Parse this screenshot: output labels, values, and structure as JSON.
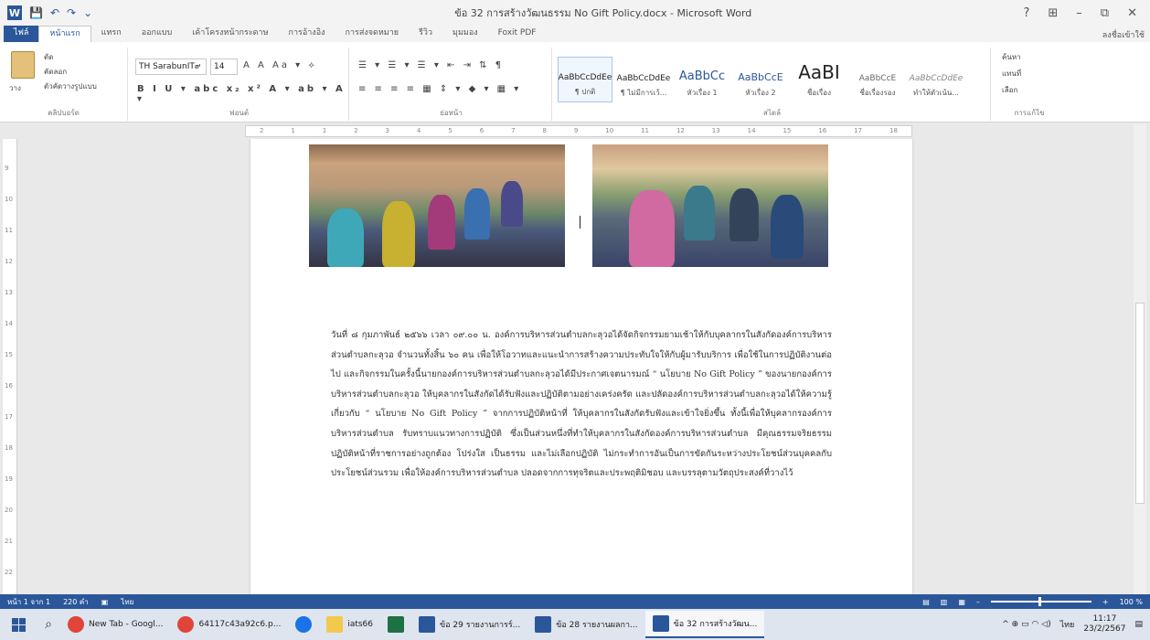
{
  "window": {
    "title": "ข้อ 32 การสร้างวัฒนธรรม No Gift Policy.docx - Microsoft Word",
    "controls": [
      "?",
      "⊞",
      "–",
      "⧉",
      "✕"
    ],
    "signin": "ลงชื่อเข้าใช้"
  },
  "qat": [
    "💾",
    "↶",
    "↷",
    "⌄"
  ],
  "tabs": [
    "ไฟล์",
    "หน้าแรก",
    "แทรก",
    "ออกแบบ",
    "เค้าโครงหน้ากระดาษ",
    "การอ้างอิง",
    "การส่งจดหมาย",
    "รีวิว",
    "มุมมอง",
    "Foxit PDF"
  ],
  "ribbon": {
    "clipboard": {
      "paste": "วาง",
      "cut": "ตัด",
      "copy": "คัดลอก",
      "format_painter": "ตัวคัดวางรูปแบบ",
      "label": "คลิปบอร์ด"
    },
    "font": {
      "name": "TH SarabunIT๙",
      "size": "14",
      "row1": "A A Aa ▾ ⟡",
      "row2": "B I U ▾ abc x₂ x²  A ▾ ab ▾ A ▾",
      "label": "ฟอนต์"
    },
    "paragraph": {
      "row1": "☰ ▾ ☰ ▾ ☰ ▾  ⇤ ⇥  ⇅  ¶",
      "row2": "≡ ≡ ≡ ≡  ▦  ⇕ ▾  ◆ ▾ ▦ ▾",
      "label": "ย่อหน้า"
    },
    "styles": {
      "items": [
        {
          "sample": "AaBbCcDdEe",
          "name": "¶ ปกติ"
        },
        {
          "sample": "AaBbCcDdEe",
          "name": "¶ ไม่มีการเว้..."
        },
        {
          "sample": "AaBbCc",
          "name": "หัวเรื่อง 1"
        },
        {
          "sample": "AaBbCcE",
          "name": "หัวเรื่อง 2"
        },
        {
          "sample": "AaBI",
          "name": "ชื่อเรื่อง"
        },
        {
          "sample": "AaBbCcE",
          "name": "ชื่อเรื่องรอง"
        },
        {
          "sample": "AaBbCcDdEe",
          "name": "ทำให้ตัวเน้น..."
        }
      ],
      "label": "สไตล์"
    },
    "editing": {
      "find": "ค้นหา",
      "replace": "แทนที่",
      "select": "เลือก",
      "label": "การแก้ไข"
    }
  },
  "ruler": [
    "2",
    "1",
    "1",
    "2",
    "3",
    "4",
    "5",
    "6",
    "7",
    "8",
    "9",
    "10",
    "11",
    "12",
    "13",
    "14",
    "15",
    "16",
    "17",
    "18"
  ],
  "vruler": [
    "9",
    "10",
    "11",
    "12",
    "13",
    "14",
    "15",
    "16",
    "17",
    "18",
    "19",
    "20",
    "21",
    "22"
  ],
  "document": {
    "paragraph": "วันที่ ๘ กุมภาพันธ์ ๒๕๖๖ เวลา ๐๙.๐๐ น. องค์การบริหารส่วนตำบลกะลุวอได้จัดกิจกรรมยามเช้าให้กับบุคลากรในสังกัดองค์การบริหารส่วนตำบลกะลุวอ จำนวนทั้งสิ้น ๖๐ คน เพื่อให้โอวาทและแนะนำการสร้างความประทับใจให้กับผู้มารับบริการ เพื่อใช้ในการปฏิบัติงานต่อไป และกิจกรรมในครั้งนี้นายกองค์การบริหารส่วนตำบลกะลุวอได้มีประกาศเจตนารมณ์ “ นโยบาย No Gift Policy ” ของนายกองค์การบริหารส่วนตำบลกะลุวอ ให้บุคลากรในสังกัดได้รับฟังและปฏิบัติตามอย่างเคร่งครัด และปลัดองค์การบริหารส่วนตำบลกะลุวอได้ให้ความรู้เกี่ยวกับ “ นโยบาย No Gift Policy ” จากการปฏิบัติหน้าที่ ให้บุคลากรในสังกัดรับฟังและเข้าใจยิ่งขึ้น ทั้งนี้เพื่อให้บุคลากรองค์การบริหารส่วนตำบล รับทราบแนวทางการปฏิบัติ ซึ่งเป็นส่วนหนึ่งที่ทำให้บุคลากรในสังกัดองค์การบริหารส่วนตำบล มีคุณธรรมจริยธรรมปฏิบัติหน้าที่ราชการอย่างถูกต้อง โปร่งใส เป็นธรรม และไม่เลือกปฏิบัติ ไม่กระทำการอันเป็นการขัดกันระหว่างประโยชน์ส่วนบุคคลกับประโยชน์ส่วนรวม เพื่อให้องค์การบริหารส่วนตำบล ปลอดจากการทุจริตและประพฤติมิชอบ และบรรลุตามวัตถุประสงค์ที่วางไว้"
  },
  "status": {
    "page": "หน้า 1 จาก 1",
    "words": "220 คำ",
    "lang": "ไทย",
    "zoom": "100 %"
  },
  "taskbar": {
    "items": [
      {
        "label": "New Tab - Googl...",
        "color": "#e0453a"
      },
      {
        "label": "64117c43a92c6.p...",
        "color": "#e0453a"
      },
      {
        "label": "",
        "color": "#1a73e8"
      },
      {
        "label": "iats66",
        "color": "#f2c94c"
      },
      {
        "label": "",
        "color": "#1e7145"
      },
      {
        "label": "ข้อ 29 รายงานการร์...",
        "color": "#2b579a"
      },
      {
        "label": "ข้อ 28 รายงานผลกา...",
        "color": "#2b579a"
      },
      {
        "label": "ข้อ 32 การสร้างวัฒน...",
        "color": "#2b579a"
      }
    ],
    "tray": {
      "icons": "^ ⊕ ▭ ◠ ◁)",
      "lang": "ไทย",
      "time": "11:17",
      "date": "23/2/2567"
    }
  }
}
